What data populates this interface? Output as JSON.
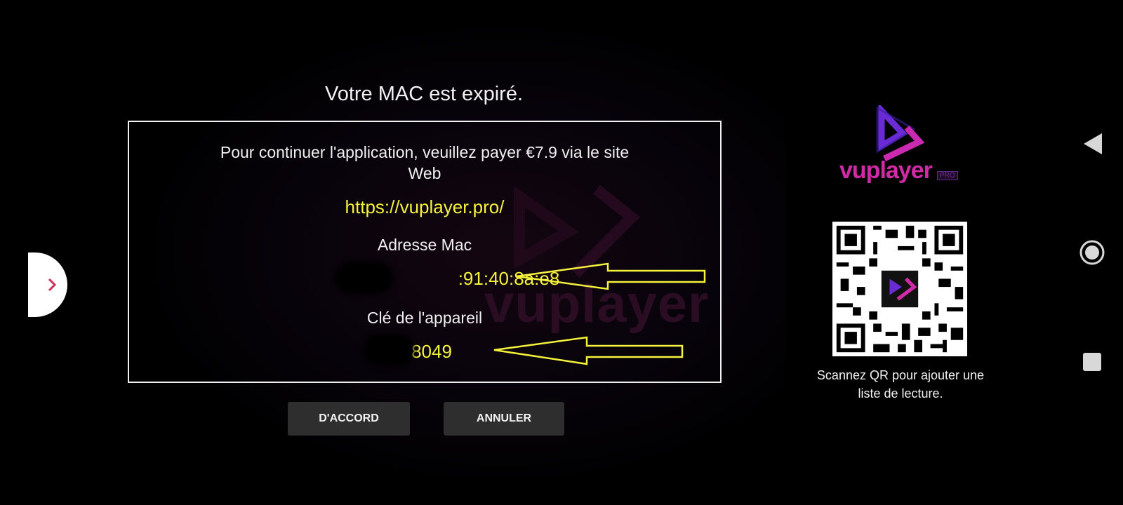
{
  "dialog": {
    "title": "Votre MAC est expiré.",
    "message": "Pour continuer l'application, veuillez payer €7.9 via le site Web",
    "url": "https://vuplayer.pro/",
    "mac_label": "Adresse Mac",
    "mac_value": ":91:40:8a:e8",
    "device_key_label": "Clé de l'appareil",
    "device_key_value": "8049",
    "ok_button": "D'ACCORD",
    "cancel_button": "ANNULER"
  },
  "brand": {
    "logo_text": "vuplayer",
    "logo_badge": "PRO",
    "watermark_text": "vuplayer",
    "accent_color": "#d12aa6",
    "secondary_color": "#6a2bd6"
  },
  "qr": {
    "caption": "Scannez QR pour ajouter une liste de lecture."
  },
  "annotations": {
    "arrow_color": "#f4f23c"
  },
  "side_tab": {
    "icon": "chevron-right-icon"
  },
  "system_nav": {
    "back": "back-icon",
    "home": "home-icon",
    "recents": "recents-icon"
  }
}
